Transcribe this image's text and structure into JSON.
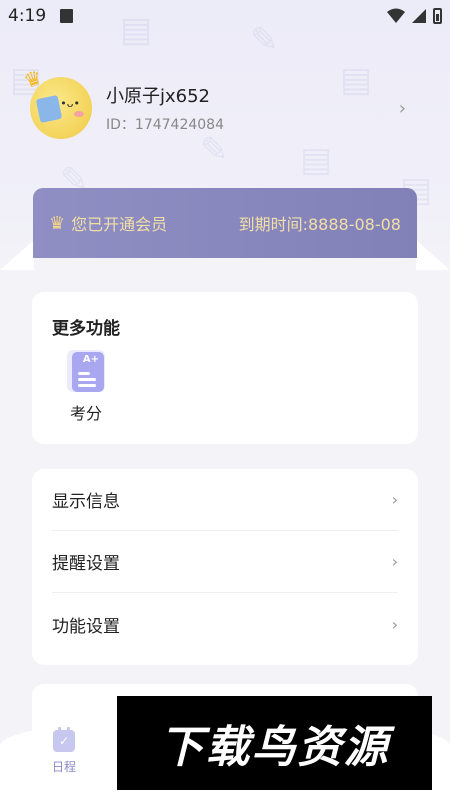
{
  "status_bar": {
    "time": "4:19"
  },
  "profile": {
    "username": "小原子jx652",
    "user_id": "ID：1747424084"
  },
  "vip": {
    "status": "您已开通会员",
    "expire": "到期时间:8888-08-08"
  },
  "more_functions": {
    "title": "更多功能",
    "items": [
      {
        "label": "考分",
        "icon": "exam-score-icon"
      }
    ]
  },
  "settings": {
    "items": [
      {
        "label": "显示信息"
      },
      {
        "label": "提醒设置"
      },
      {
        "label": "功能设置"
      }
    ]
  },
  "bottom_nav": {
    "tabs": [
      {
        "label": "日程",
        "icon": "calendar-icon"
      }
    ]
  },
  "watermark": {
    "text": "下载鸟资源"
  },
  "colors": {
    "vip_banner": "#8585bc",
    "vip_text": "#f3dfa8",
    "accent": "#a9a7ef"
  }
}
